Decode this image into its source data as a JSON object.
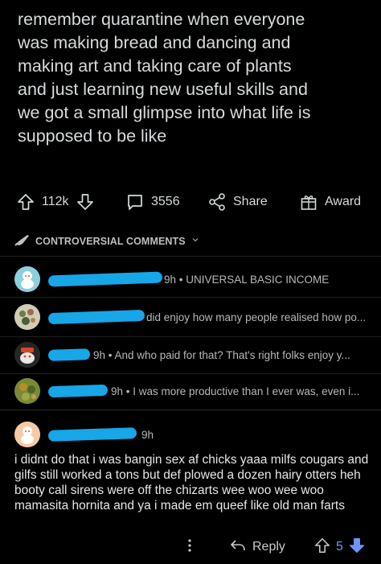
{
  "post": {
    "body": "remember quarantine when everyone\nwas making bread and dancing and\nmaking art and taking care of plants\nand just learning new useful skills and\nwe got a small glimpse into what life is\nsupposed to be like"
  },
  "actions": {
    "upvotes": "112k",
    "comments": "3556",
    "share_label": "Share",
    "award_label": "Award"
  },
  "sort": {
    "label": "CONTROVERSIAL COMMENTS"
  },
  "comments": [
    {
      "meta": "9h • UNIVERSAL BASIC INCOME"
    },
    {
      "meta": "did enjoy how many people realised how po..."
    },
    {
      "meta": "9h • And who paid for that? That's right folks enjoy y..."
    },
    {
      "meta": "9h • I was more productive than I ever was, even i..."
    }
  ],
  "expanded_comment": {
    "age": "9h",
    "text": "i didnt do that i was bangin sex af chicks yaaa milfs cougars and gilfs still worked a tons but def plowed a dozen hairy otters heh booty call sirens were off the chizarts wee woo wee woo mamasita hornita and ya i made em queef like old man farts",
    "reply_label": "Reply",
    "score": "5"
  },
  "colors": {
    "redaction": "#17a6e8",
    "downvote_active": "#7193ff",
    "background": "#000000"
  }
}
